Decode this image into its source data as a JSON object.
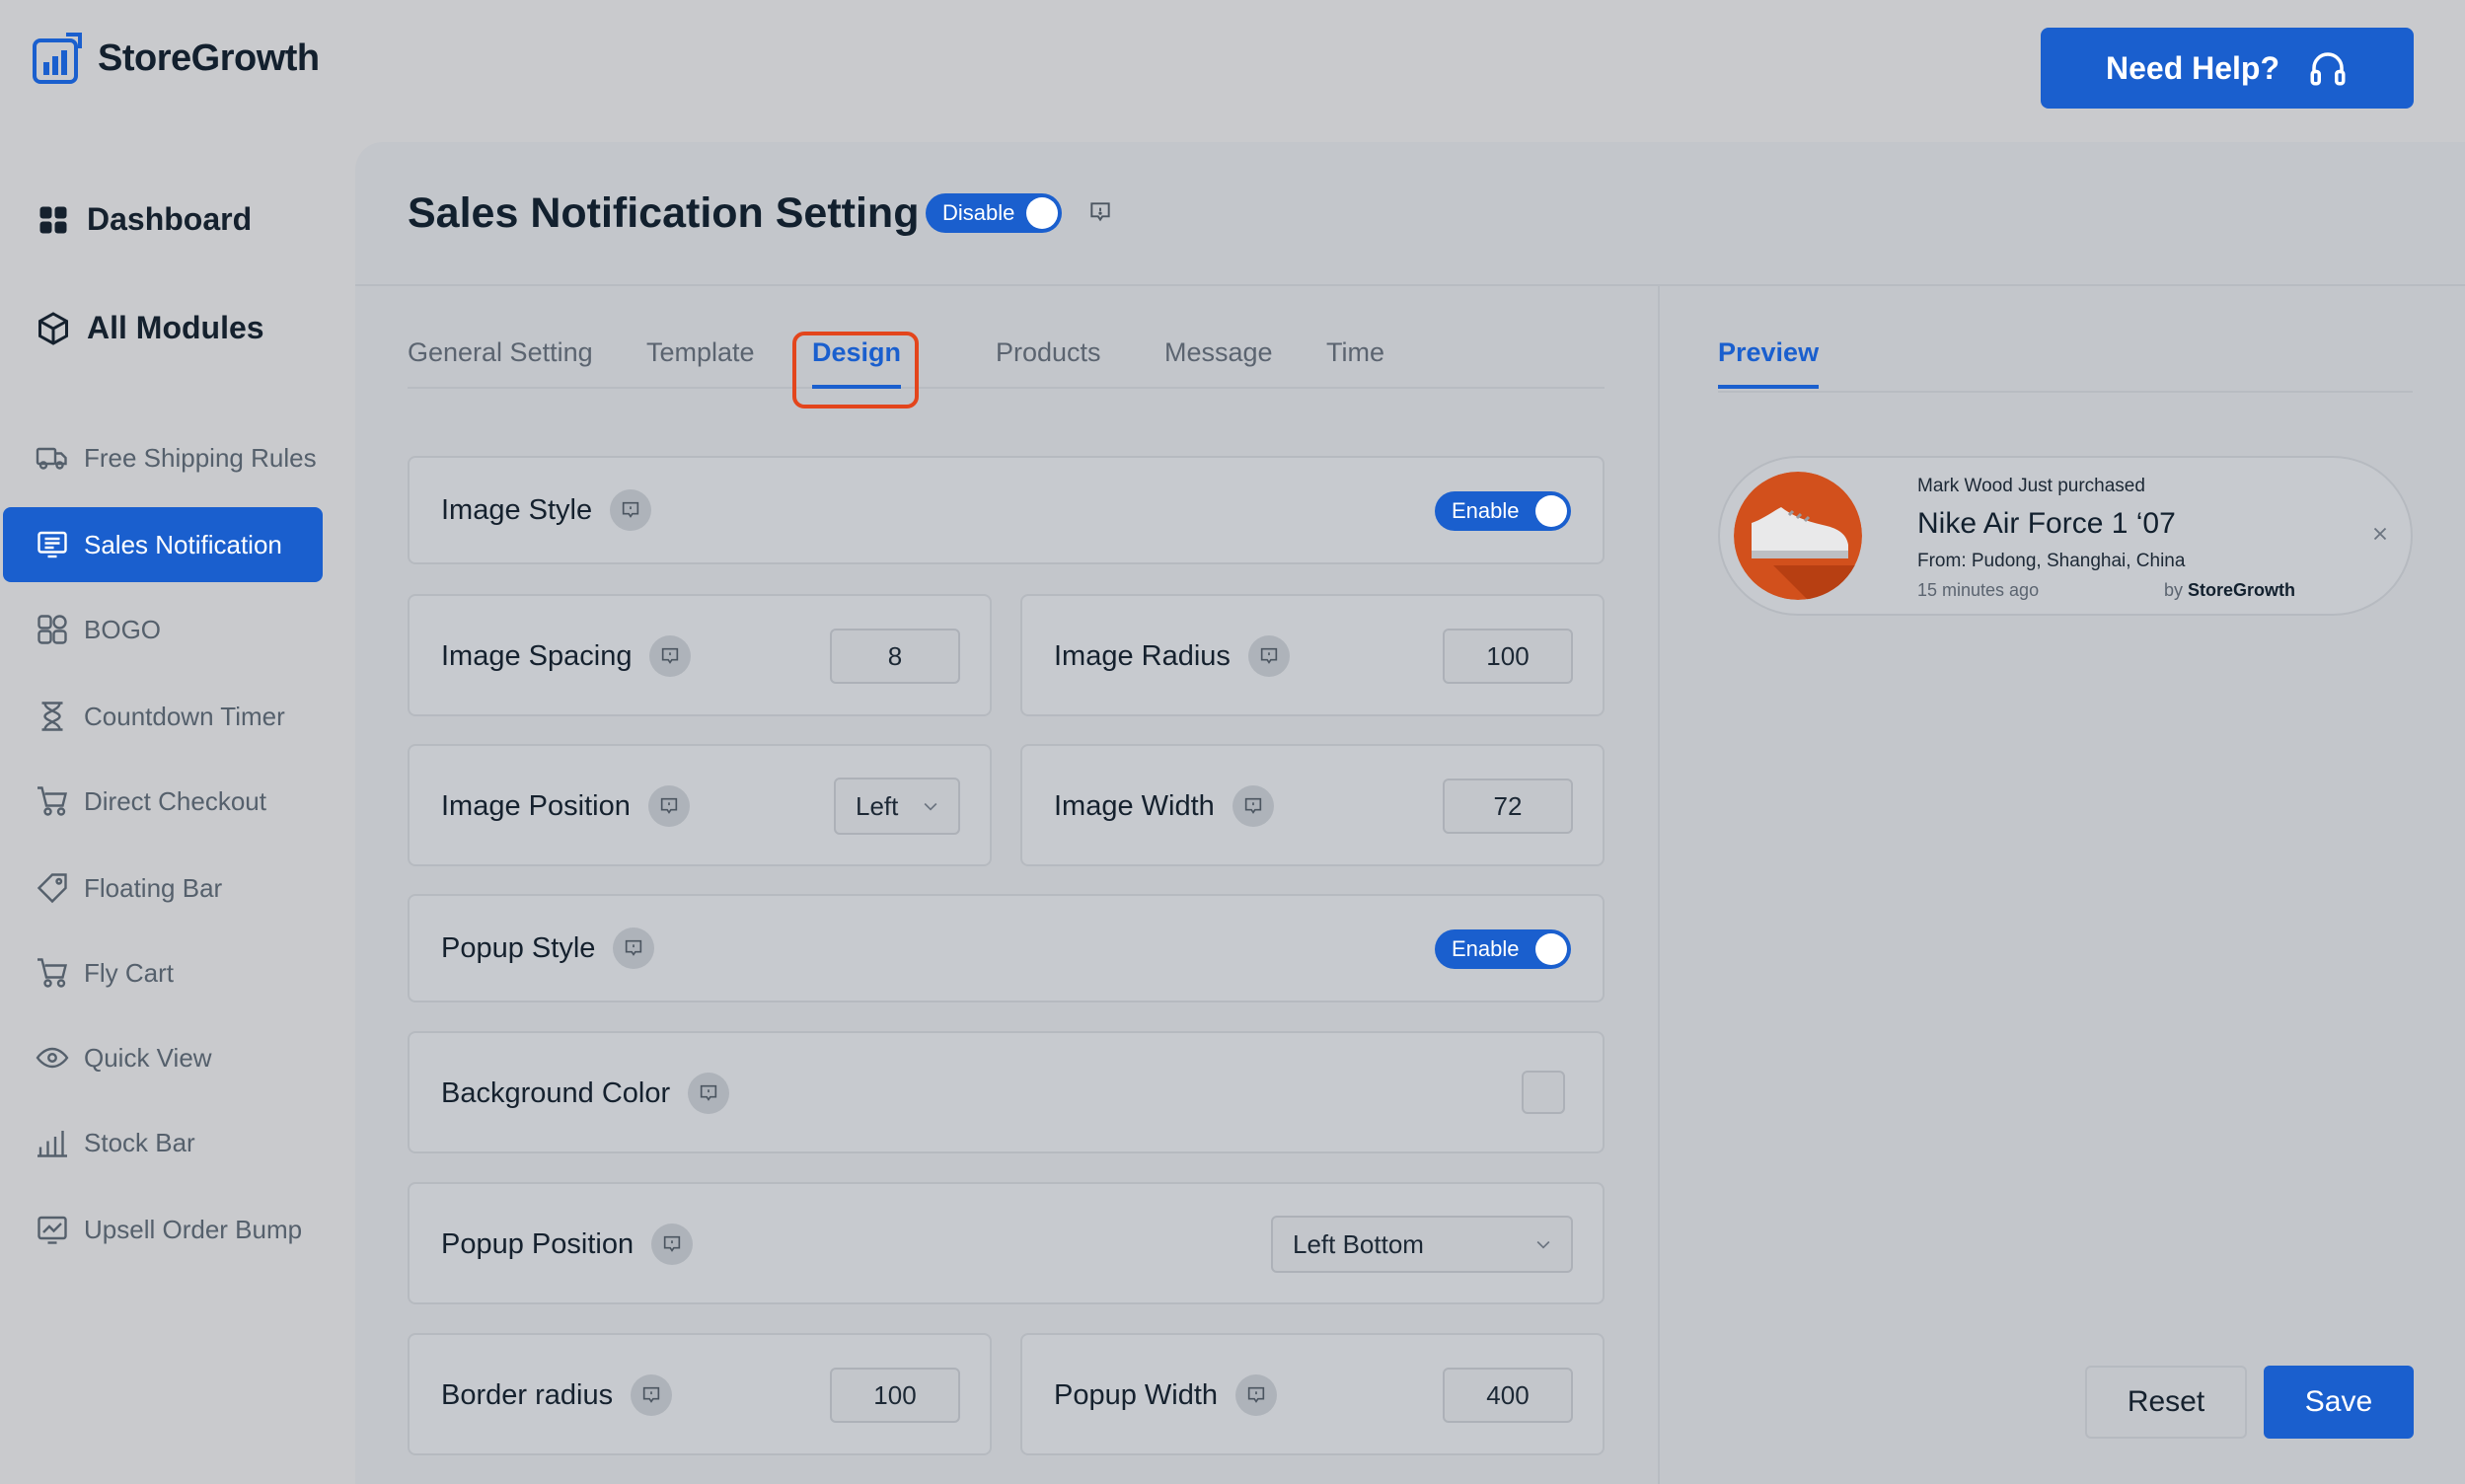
{
  "brand": {
    "name": "StoreGrowth"
  },
  "header": {
    "help_label": "Need Help?"
  },
  "sidebar": {
    "dashboard": "Dashboard",
    "all_modules": "All Modules",
    "items": [
      {
        "label": "Free Shipping Rules",
        "icon": "truck-icon"
      },
      {
        "label": "Sales Notification",
        "icon": "notification-icon",
        "active": true
      },
      {
        "label": "BOGO",
        "icon": "bogo-icon"
      },
      {
        "label": "Countdown Timer",
        "icon": "hourglass-icon"
      },
      {
        "label": "Direct Checkout",
        "icon": "cart-icon"
      },
      {
        "label": "Floating Bar",
        "icon": "tag-icon"
      },
      {
        "label": "Fly Cart",
        "icon": "cart-icon"
      },
      {
        "label": "Quick View",
        "icon": "eye-icon"
      },
      {
        "label": "Stock Bar",
        "icon": "bar-chart-icon"
      },
      {
        "label": "Upsell Order Bump",
        "icon": "chart-icon"
      }
    ]
  },
  "page": {
    "title": "Sales Notification Setting",
    "toggle_label": "Disable",
    "tabs": [
      "General Setting",
      "Template",
      "Design",
      "Products",
      "Message",
      "Time"
    ],
    "active_tab": "Design"
  },
  "settings": {
    "image_style": {
      "label": "Image Style",
      "toggle": "Enable"
    },
    "image_spacing": {
      "label": "Image Spacing",
      "value": "8"
    },
    "image_radius": {
      "label": "Image Radius",
      "value": "100"
    },
    "image_position": {
      "label": "Image Position",
      "value": "Left"
    },
    "image_width": {
      "label": "Image Width",
      "value": "72"
    },
    "popup_style": {
      "label": "Popup Style",
      "toggle": "Enable"
    },
    "background_color": {
      "label": "Background Color"
    },
    "popup_position": {
      "label": "Popup Position",
      "value": "Left Bottom"
    },
    "border_radius": {
      "label": "Border radius",
      "value": "100"
    },
    "popup_width": {
      "label": "Popup Width",
      "value": "400"
    }
  },
  "preview": {
    "tab": "Preview",
    "purchaser": "Mark Wood Just purchased",
    "product": "Nike Air Force 1 ‘07",
    "location": "From: Pudong, Shanghai, China",
    "time_ago": "15 minutes ago",
    "by_prefix": "by",
    "by_brand": "StoreGrowth"
  },
  "actions": {
    "reset": "Reset",
    "save": "Save"
  },
  "colors": {
    "accent": "#1a5fce",
    "highlight": "#e3451c",
    "product_circle": "#d2501c"
  }
}
